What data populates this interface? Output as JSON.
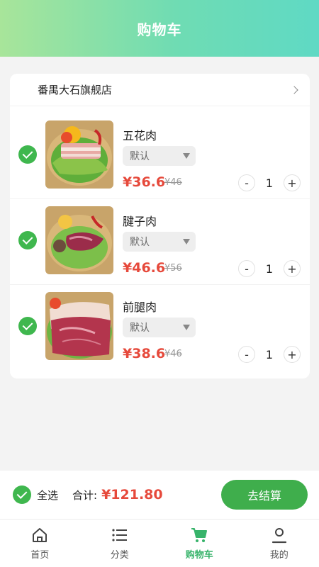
{
  "header": {
    "title": "购物车"
  },
  "store": {
    "name": "番禺大石旗舰店"
  },
  "items": [
    {
      "name": "五花肉",
      "spec": "默认",
      "price": "¥36.6",
      "original_price": "¥46",
      "quantity": "1",
      "checked": true
    },
    {
      "name": "腱子肉",
      "spec": "默认",
      "price": "¥46.6",
      "original_price": "¥56",
      "quantity": "1",
      "checked": true
    },
    {
      "name": "前腿肉",
      "spec": "默认",
      "price": "¥38.6",
      "original_price": "¥46",
      "quantity": "1",
      "checked": true
    }
  ],
  "stepper": {
    "minus": "-",
    "plus": "+"
  },
  "bottom_bar": {
    "select_all": "全选",
    "total_label": "合计:",
    "total_value": "¥121.80",
    "checkout": "去结算"
  },
  "tabbar": [
    {
      "label": "首页",
      "icon": "home-icon",
      "active": false
    },
    {
      "label": "分类",
      "icon": "list-icon",
      "active": false
    },
    {
      "label": "购物车",
      "icon": "cart-icon",
      "active": true
    },
    {
      "label": "我的",
      "icon": "user-icon",
      "active": false
    }
  ],
  "colors": {
    "accent": "#3fb74e",
    "price": "#e6493b",
    "active_tab": "#37b36a"
  }
}
